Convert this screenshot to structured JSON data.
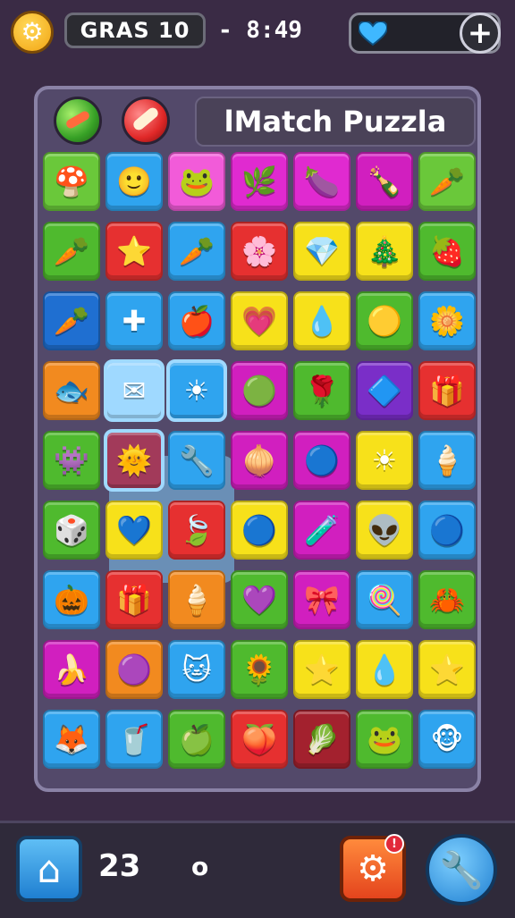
{
  "topbar": {
    "gear_icon": "gear-icon",
    "level_label": "GRAS 10",
    "timer_text": "- 8:49",
    "lives_icon": "heart-icon",
    "add_lives_icon": "plus-icon"
  },
  "header": {
    "title": "lMatch Puzzla",
    "booster1_icon": "green-ball-icon",
    "booster2_icon": "candy-ball-icon"
  },
  "grid": {
    "rows": 9,
    "cols": 7,
    "selected_tiles": [
      [
        3,
        1
      ],
      [
        3,
        2
      ],
      [
        4,
        1
      ]
    ],
    "tiles": [
      [
        {
          "color": "#6ac83a",
          "glyph": "🍄"
        },
        {
          "color": "#2fa4ef",
          "glyph": "🙂"
        },
        {
          "color": "#f25bd9",
          "glyph": "🐸"
        },
        {
          "color": "#e02ad0",
          "glyph": "🌿"
        },
        {
          "color": "#e02ad0",
          "glyph": "🍆"
        },
        {
          "color": "#d11fbf",
          "glyph": "🍾"
        },
        {
          "color": "#6ac83a",
          "glyph": "🥕"
        }
      ],
      [
        {
          "color": "#4fba2e",
          "glyph": "🥕"
        },
        {
          "color": "#e63030",
          "glyph": "⭐"
        },
        {
          "color": "#2fa4ef",
          "glyph": "🥕"
        },
        {
          "color": "#e63030",
          "glyph": "🌸"
        },
        {
          "color": "#f7e11a",
          "glyph": "💎"
        },
        {
          "color": "#f7e11a",
          "glyph": "🎄"
        },
        {
          "color": "#4fba2e",
          "glyph": "🍓"
        }
      ],
      [
        {
          "color": "#1f6fd1",
          "glyph": "🥕"
        },
        {
          "color": "#2fa4ef",
          "glyph": "✚"
        },
        {
          "color": "#2fa4ef",
          "glyph": "🍎"
        },
        {
          "color": "#f7e11a",
          "glyph": "💗"
        },
        {
          "color": "#f7e11a",
          "glyph": "💧"
        },
        {
          "color": "#4fba2e",
          "glyph": "🟡"
        },
        {
          "color": "#2fa4ef",
          "glyph": "🌼"
        }
      ],
      [
        {
          "color": "#f28a1f",
          "glyph": "🐟"
        },
        {
          "color": "#9fd9ff",
          "glyph": "✉"
        },
        {
          "color": "#2fa4ef",
          "glyph": "☀"
        },
        {
          "color": "#d11fbf",
          "glyph": "🟢"
        },
        {
          "color": "#4fba2e",
          "glyph": "🌹"
        },
        {
          "color": "#7a2ec8",
          "glyph": "🔷"
        },
        {
          "color": "#e63030",
          "glyph": "🎁"
        }
      ],
      [
        {
          "color": "#4fba2e",
          "glyph": "👾"
        },
        {
          "color": "#a23a5a",
          "glyph": "🌞"
        },
        {
          "color": "#2fa4ef",
          "glyph": "🔧"
        },
        {
          "color": "#d11fbf",
          "glyph": "🧅"
        },
        {
          "color": "#d11fbf",
          "glyph": "🔵"
        },
        {
          "color": "#f7e11a",
          "glyph": "☀"
        },
        {
          "color": "#2fa4ef",
          "glyph": "🍦"
        }
      ],
      [
        {
          "color": "#4fba2e",
          "glyph": "🎲"
        },
        {
          "color": "#f7e11a",
          "glyph": "💙"
        },
        {
          "color": "#e63030",
          "glyph": "🍃"
        },
        {
          "color": "#f7e11a",
          "glyph": "🔵"
        },
        {
          "color": "#d11fbf",
          "glyph": "🧪"
        },
        {
          "color": "#f7e11a",
          "glyph": "👽"
        },
        {
          "color": "#2fa4ef",
          "glyph": "🔵"
        }
      ],
      [
        {
          "color": "#2fa4ef",
          "glyph": "🎃"
        },
        {
          "color": "#e63030",
          "glyph": "🎁"
        },
        {
          "color": "#f28a1f",
          "glyph": "🍦"
        },
        {
          "color": "#4fba2e",
          "glyph": "💜"
        },
        {
          "color": "#d11fbf",
          "glyph": "🎀"
        },
        {
          "color": "#2fa4ef",
          "glyph": "🍭"
        },
        {
          "color": "#4fba2e",
          "glyph": "🦀"
        }
      ],
      [
        {
          "color": "#d11fbf",
          "glyph": "🍌"
        },
        {
          "color": "#f28a1f",
          "glyph": "🟣"
        },
        {
          "color": "#2fa4ef",
          "glyph": "🐱"
        },
        {
          "color": "#4fba2e",
          "glyph": "🌻"
        },
        {
          "color": "#f7e11a",
          "glyph": "⭐"
        },
        {
          "color": "#f7e11a",
          "glyph": "💧"
        },
        {
          "color": "#f7e11a",
          "glyph": "⭐"
        }
      ],
      [
        {
          "color": "#2fa4ef",
          "glyph": "🦊"
        },
        {
          "color": "#2fa4ef",
          "glyph": "🥤"
        },
        {
          "color": "#4fba2e",
          "glyph": "🍏"
        },
        {
          "color": "#e63030",
          "glyph": "🍑"
        },
        {
          "color": "#a3212e",
          "glyph": "🥬"
        },
        {
          "color": "#4fba2e",
          "glyph": "🐸"
        },
        {
          "color": "#2fa4ef",
          "glyph": "🐵"
        }
      ]
    ]
  },
  "bottombar": {
    "home_icon": "home-icon",
    "score": "23",
    "moves": "o",
    "settings_icon": "settings-icon",
    "tool_icon": "wrench-icon"
  }
}
